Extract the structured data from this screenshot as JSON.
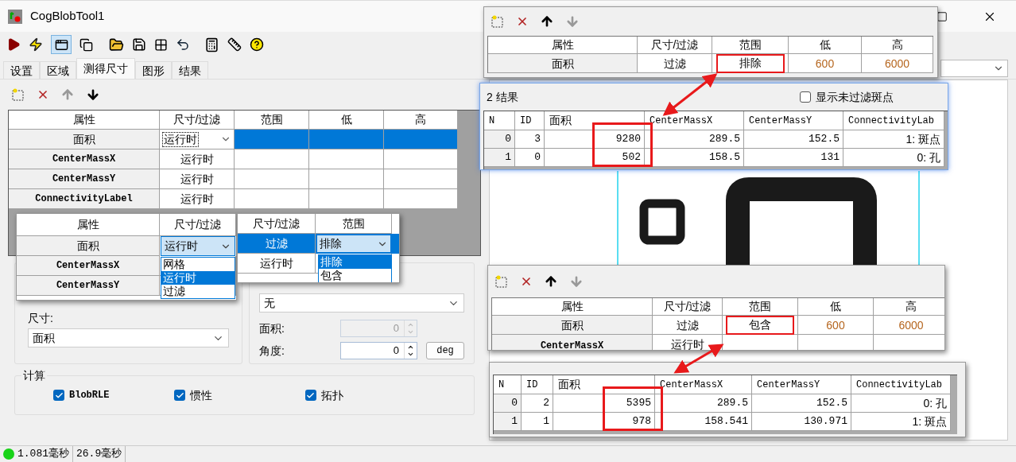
{
  "window": {
    "title": "CogBlobTool1"
  },
  "tabs": [
    {
      "label": "设置",
      "selected": false
    },
    {
      "label": "区域",
      "selected": false
    },
    {
      "label": "测得尺寸",
      "selected": true
    },
    {
      "label": "图形",
      "selected": false
    },
    {
      "label": "结果",
      "selected": false
    }
  ],
  "toolbar": {
    "up_disabled": true,
    "down_disabled": false
  },
  "measure_table": {
    "columns": [
      "属性",
      "尺寸/过滤",
      "范围",
      "低",
      "高"
    ],
    "rows": [
      {
        "property": "面积",
        "mode": "运行时",
        "selected": true
      },
      {
        "property": "CenterMassX",
        "mode": "运行时",
        "selected": false
      },
      {
        "property": "CenterMassY",
        "mode": "运行时",
        "selected": false
      },
      {
        "property": "ConnectivityLabel",
        "mode": "运行时",
        "selected": false
      }
    ]
  },
  "size": {
    "label": "尺寸:",
    "value": "面积"
  },
  "exclusion": {
    "mode_value": "无",
    "fields": [
      {
        "label": "面积:",
        "value": "0",
        "disabled": true
      },
      {
        "label": "角度:",
        "value": "0",
        "disabled": false,
        "unit": "deg"
      }
    ]
  },
  "compute": {
    "title": "计算",
    "options": [
      {
        "label": "BlobRLE",
        "checked": true
      },
      {
        "label": "惯性",
        "checked": true
      },
      {
        "label": "拓扑",
        "checked": true
      }
    ]
  },
  "status_bar": [
    "1.081毫秒",
    "26.9毫秒"
  ],
  "mode_dropdown_snapshot": {
    "columns": [
      "属性",
      "尺寸/过滤"
    ],
    "rows": [
      {
        "property": "面积",
        "mode": "运行时"
      },
      {
        "property": "CenterMassX"
      },
      {
        "property": "CenterMassY"
      }
    ],
    "options": [
      {
        "label": "网格",
        "selected": false
      },
      {
        "label": "运行时",
        "selected": true
      },
      {
        "label": "过滤",
        "selected": false
      }
    ]
  },
  "range_dropdown_snapshot": {
    "columns": [
      "尺寸/过滤",
      "范围"
    ],
    "rows": [
      {
        "mode": "过滤",
        "range": "排除",
        "selected": true
      },
      {
        "mode": "运行时",
        "selected": false
      }
    ],
    "options": [
      {
        "label": "排除",
        "selected": true
      },
      {
        "label": "包含",
        "selected": false
      }
    ]
  },
  "comparisons": [
    {
      "toolbar": {
        "up_disabled": false,
        "down_disabled": true
      },
      "filter_table": {
        "columns": [
          "属性",
          "尺寸/过滤",
          "范围",
          "低",
          "高"
        ],
        "rows": [
          [
            {
              "text": "面积",
              "highlighted": false
            },
            {
              "text": "过滤",
              "highlighted": false
            },
            {
              "text": "排除",
              "highlighted": true
            },
            {
              "text": "600",
              "highlighted": false
            },
            {
              "text": "6000",
              "highlighted": false
            }
          ]
        ]
      },
      "results": {
        "title": "2 结果",
        "show_unfiltered": {
          "label": "显示未过滤斑点",
          "checked": false
        },
        "columns": [
          {
            "label": "N",
            "highlighted": false
          },
          {
            "label": "ID",
            "highlighted": false
          },
          {
            "label": "面积",
            "highlighted": true
          },
          {
            "label": "CenterMassX",
            "highlighted": false
          },
          {
            "label": "CenterMassY",
            "highlighted": false
          },
          {
            "label": "ConnectivityLab",
            "highlighted": false
          }
        ],
        "rows": [
          [
            "0",
            "3",
            "9280",
            "289.5",
            "152.5",
            "1: 斑点"
          ],
          [
            "1",
            "0",
            "502",
            "158.5",
            "131",
            "0: 孔"
          ]
        ]
      }
    },
    {
      "toolbar": {
        "up_disabled": false,
        "down_disabled": true
      },
      "filter_table": {
        "columns": [
          "属性",
          "尺寸/过滤",
          "范围",
          "低",
          "高"
        ],
        "rows": [
          [
            {
              "text": "面积",
              "highlighted": false
            },
            {
              "text": "过滤",
              "highlighted": false
            },
            {
              "text": "包含",
              "highlighted": true
            },
            {
              "text": "600",
              "highlighted": false
            },
            {
              "text": "6000",
              "highlighted": false
            }
          ],
          [
            {
              "text": "CenterMassX",
              "highlighted": false
            },
            {
              "text": "运行时",
              "highlighted": false
            }
          ]
        ]
      },
      "results": {
        "columns": [
          {
            "label": "N",
            "highlighted": false
          },
          {
            "label": "ID",
            "highlighted": false
          },
          {
            "label": "面积",
            "highlighted": true
          },
          {
            "label": "CenterMassX",
            "highlighted": false
          },
          {
            "label": "CenterMassY",
            "highlighted": false
          },
          {
            "label": "ConnectivityLab",
            "highlighted": false
          }
        ],
        "rows": [
          [
            "0",
            "2",
            "5395",
            "289.5",
            "152.5",
            "0: 孔"
          ],
          [
            "1",
            "1",
            "978",
            "158.541",
            "130.971",
            "1: 斑点"
          ]
        ]
      }
    }
  ]
}
